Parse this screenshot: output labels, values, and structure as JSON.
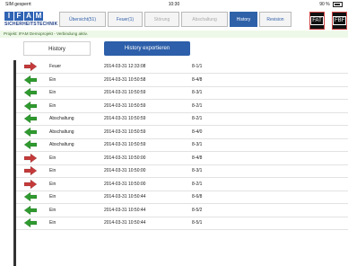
{
  "status_bar": {
    "carrier": "SIM gesperrt",
    "time": "10:30",
    "battery": "90 %"
  },
  "logo": {
    "letters": [
      "I",
      "F",
      "A",
      "M"
    ],
    "subtitle": "SICHERHEITSTECHNIK"
  },
  "tabs": [
    {
      "label": "Übersicht(51)",
      "state": "normal"
    },
    {
      "label": "Feuer(1)",
      "state": "normal"
    },
    {
      "label": "Störung",
      "state": "disabled"
    },
    {
      "label": "Abschaltung",
      "state": "disabled"
    },
    {
      "label": "History",
      "state": "active"
    },
    {
      "label": "Revision",
      "state": "normal"
    }
  ],
  "fat_button": {
    "label": "FAT"
  },
  "fbf_button": {
    "label": "FBF"
  },
  "breadcrumb": "Projekt: IFAM Demoprojekt - Verbindung aktiv.",
  "toolbar": {
    "history_label": "History",
    "export_label": "History exportieren"
  },
  "colors": {
    "accent": "#2f61a9",
    "arrow_in": "#c43a3a",
    "arrow_out": "#2f9a2f"
  },
  "rows": [
    {
      "direction": "right",
      "color": "#c43a3a",
      "label": "Feuer",
      "timestamp": "2014-03-31 12:33:08",
      "code": "8-1/1"
    },
    {
      "direction": "left",
      "color": "#2f9a2f",
      "label": "Ein",
      "timestamp": "2014-03-31 10:50:58",
      "code": "8-4/8"
    },
    {
      "direction": "left",
      "color": "#2f9a2f",
      "label": "Ein",
      "timestamp": "2014-03-31 10:50:59",
      "code": "8-3/1"
    },
    {
      "direction": "left",
      "color": "#2f9a2f",
      "label": "Ein",
      "timestamp": "2014-03-31 10:50:59",
      "code": "8-2/1"
    },
    {
      "direction": "left",
      "color": "#2f9a2f",
      "label": "Abschaltung",
      "timestamp": "2014-03-31 10:50:59",
      "code": "8-2/1"
    },
    {
      "direction": "left",
      "color": "#2f9a2f",
      "label": "Abschaltung",
      "timestamp": "2014-03-31 10:50:59",
      "code": "8-4/0"
    },
    {
      "direction": "left",
      "color": "#2f9a2f",
      "label": "Abschaltung",
      "timestamp": "2014-03-31 10:50:59",
      "code": "8-3/1"
    },
    {
      "direction": "right",
      "color": "#c43a3a",
      "label": "Ein",
      "timestamp": "2014-03-31 10:50:00",
      "code": "8-4/8"
    },
    {
      "direction": "right",
      "color": "#c43a3a",
      "label": "Ein",
      "timestamp": "2014-03-31 10:50:00",
      "code": "8-3/1"
    },
    {
      "direction": "right",
      "color": "#c43a3a",
      "label": "Ein",
      "timestamp": "2014-03-31 10:50:00",
      "code": "8-2/1"
    },
    {
      "direction": "left",
      "color": "#2f9a2f",
      "label": "Ein",
      "timestamp": "2014-03-31 10:50:44",
      "code": "8-6/8"
    },
    {
      "direction": "left",
      "color": "#2f9a2f",
      "label": "Ein",
      "timestamp": "2014-03-31 10:50:44",
      "code": "8-5/2"
    },
    {
      "direction": "left",
      "color": "#2f9a2f",
      "label": "Ein",
      "timestamp": "2014-03-31 10:50:44",
      "code": "8-5/1"
    }
  ]
}
